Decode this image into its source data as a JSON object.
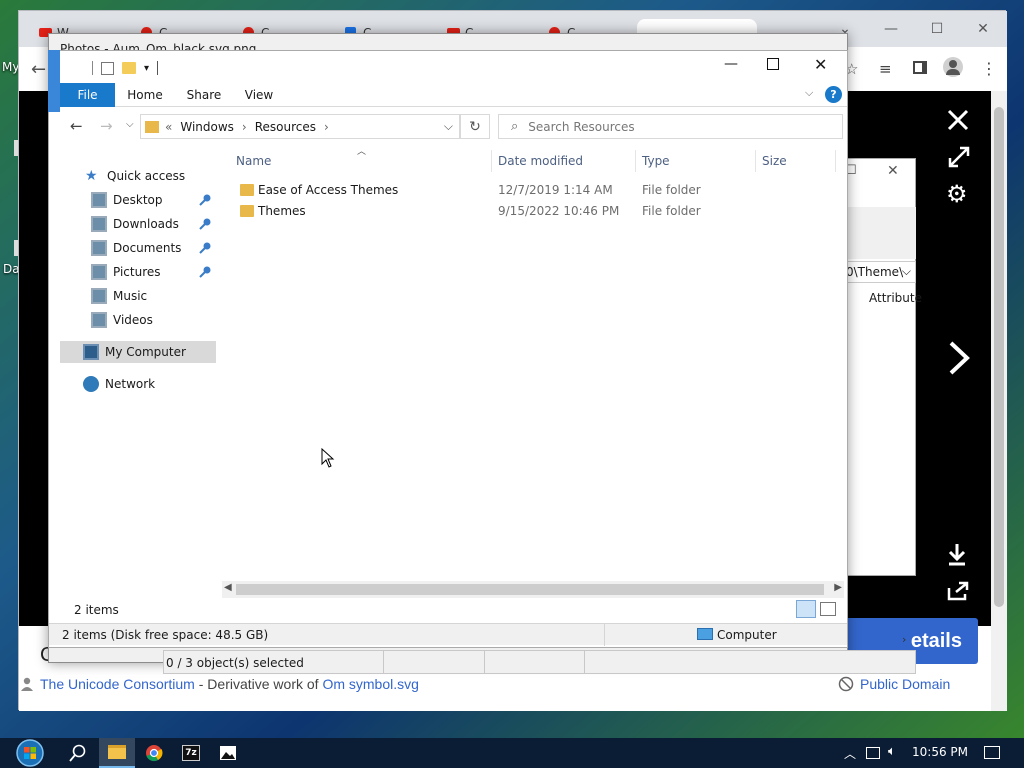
{
  "desktop": {
    "label_my": "My",
    "label_da": "Da"
  },
  "browser": {
    "tabs": [
      "W",
      "C",
      "C",
      "C",
      "C",
      "C"
    ],
    "footer": {
      "author_link": "The Unicode Consortium",
      "derivative_text": " - Derivative work of ",
      "source_link": "Om symbol.svg",
      "license": "Public Domain"
    },
    "details_label": "etails",
    "left_letter": "C"
  },
  "behind_dialog": {
    "address_fragment": "0\\Theme\\",
    "column_label": "Attribute"
  },
  "props_window": {
    "title": "Photos - Aum_Om_black.svg.png"
  },
  "explorer": {
    "ribbon_tabs": [
      "File",
      "Home",
      "Share",
      "View"
    ],
    "breadcrumb": [
      "Windows",
      "Resources"
    ],
    "search_placeholder": "Search Resources",
    "nav": {
      "quick_access": "Quick access",
      "pinned": [
        "Desktop",
        "Downloads",
        "Documents",
        "Pictures"
      ],
      "unpinned": [
        "Music",
        "Videos"
      ],
      "my_computer": "My Computer",
      "network": "Network"
    },
    "columns": [
      "Name",
      "Date modified",
      "Type",
      "Size"
    ],
    "rows": [
      {
        "name": "Ease of Access Themes",
        "date": "12/7/2019 1:14 AM",
        "type": "File folder"
      },
      {
        "name": "Themes",
        "date": "9/15/2022 10:46 PM",
        "type": "File folder"
      }
    ],
    "item_count": "2 items",
    "status_disk": "2 items (Disk free space: 48.5 GB)",
    "status_computer": "Computer",
    "status_selected": "0 / 3 object(s) selected"
  },
  "taskbar": {
    "time": "10:56 PM"
  },
  "colors": {
    "accent": "#1979ca",
    "folder": "#e8b84a",
    "wiki_blue": "#3366cc"
  }
}
